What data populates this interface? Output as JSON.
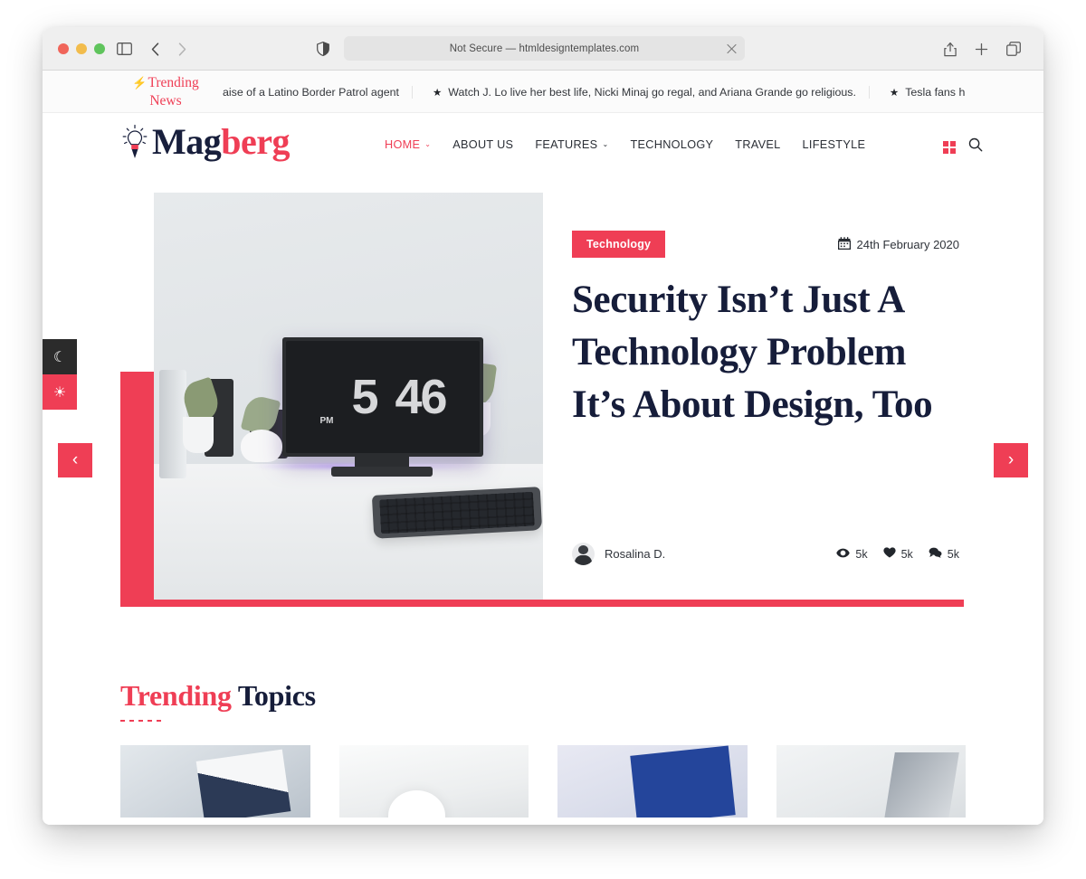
{
  "browser": {
    "url_text": "Not Secure — htmldesigntemplates.com",
    "icons": {
      "sidebar": "sidebar-icon",
      "back": "back-arrow-icon",
      "forward": "forward-arrow-icon",
      "shield": "privacy-shield-icon",
      "clear": "clear-url-icon",
      "share": "share-icon",
      "new_tab": "new-tab-icon",
      "tabs": "show-tabs-icon"
    }
  },
  "ticker": {
    "label_line1": "Trending",
    "label_line2": "News",
    "bolt": "⚡",
    "items": [
      {
        "icon": "",
        "text": "aise of a Latino Border Patrol agent"
      },
      {
        "icon": "★",
        "text": "Watch J. Lo live her best life, Nicki Minaj go regal, and Ariana Grande go religious."
      },
      {
        "icon": "★",
        "text": "Tesla fans h"
      }
    ]
  },
  "header": {
    "logo": {
      "part1": "Mag",
      "part2": "berg",
      "icon": "lightbulb-pencil-icon"
    },
    "nav": [
      {
        "label": "HOME",
        "caret": "⌄",
        "active": true
      },
      {
        "label": "ABOUT US",
        "caret": "",
        "active": false
      },
      {
        "label": "FEATURES",
        "caret": "⌄",
        "active": false
      },
      {
        "label": "TECHNOLOGY",
        "caret": "",
        "active": false
      },
      {
        "label": "TRAVEL",
        "caret": "",
        "active": false
      },
      {
        "label": "LIFESTYLE",
        "caret": "",
        "active": false
      }
    ],
    "actions": {
      "grid": "grid-view-icon",
      "search": "search-icon"
    }
  },
  "mode_toggles": {
    "dark": {
      "icon": "moon-icon",
      "glyph": "☾"
    },
    "light": {
      "icon": "sun-icon",
      "glyph": "☀"
    }
  },
  "carousel": {
    "prev": "‹",
    "next": "›"
  },
  "hero": {
    "category": "Technology",
    "date": "24th February 2020",
    "calendar_icon": "calendar-icon",
    "title": "Security Isn’t Just A Technology Problem It’s About Design, Too",
    "author": "Rosalina D.",
    "stats": [
      {
        "icon": "eye-icon",
        "glyph": "👁",
        "value": "5k"
      },
      {
        "icon": "heart-icon",
        "glyph": "♥",
        "value": "5k"
      },
      {
        "icon": "comment-icon",
        "glyph": "💬",
        "value": "5k"
      }
    ],
    "image_alt": "desk-with-monitor-photo",
    "image_time_hour": "5",
    "image_time_minute": "46",
    "image_time_period": "PM"
  },
  "trending_topics": {
    "heading_part1": "Trending",
    "heading_part2": "Topics",
    "cards": [
      {
        "name": "topic-card-notebook"
      },
      {
        "name": "topic-card-lamp"
      },
      {
        "name": "topic-card-bluebook"
      },
      {
        "name": "topic-card-laptop"
      }
    ]
  },
  "colors": {
    "accent_red": "#ef3e55",
    "headline_navy": "#161d3a",
    "toolbar_gray": "#efefef"
  }
}
